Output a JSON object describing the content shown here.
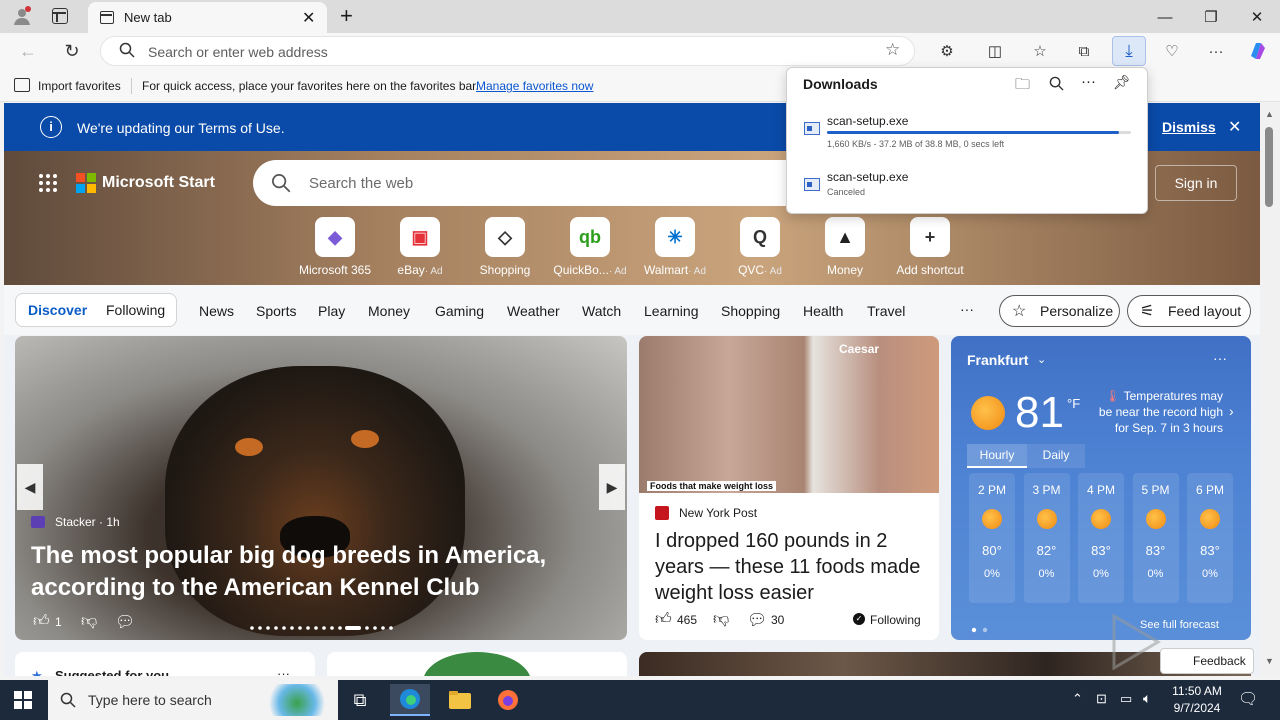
{
  "browser": {
    "tab_title": "New tab",
    "address_placeholder": "Search or enter web address"
  },
  "favorites_bar": {
    "import_label": "Import favorites",
    "hint": "For quick access, place your favorites here on the favorites bar.",
    "manage_link": "Manage favorites now"
  },
  "notice": {
    "text": "We're updating our Terms of Use.",
    "dismiss": "Dismiss"
  },
  "header": {
    "brand": "Microsoft Start",
    "search_placeholder": "Search the web",
    "sign_in": "Sign in"
  },
  "shortcuts": [
    {
      "label": "Microsoft 365",
      "ad": "",
      "icon": "m365-icon",
      "color": "#7c5cd6"
    },
    {
      "label": "eBay",
      "ad": "· Ad",
      "icon": "ebay-icon",
      "color": "#e53238"
    },
    {
      "label": "Shopping",
      "ad": "",
      "icon": "tag-icon",
      "color": "#333333"
    },
    {
      "label": "QuickBo...",
      "ad": "· Ad",
      "icon": "quickbooks-icon",
      "color": "#2ca01c"
    },
    {
      "label": "Walmart",
      "ad": "· Ad",
      "icon": "walmart-icon",
      "color": "#0071ce"
    },
    {
      "label": "QVC",
      "ad": "· Ad",
      "icon": "qvc-icon",
      "color": "#333333"
    },
    {
      "label": "Money",
      "ad": "",
      "icon": "money-icon",
      "color": "#222222"
    },
    {
      "label": "Add shortcut",
      "ad": "",
      "icon": "plus-icon",
      "color": "#333333"
    }
  ],
  "nav": {
    "discover": "Discover",
    "following": "Following",
    "items": [
      "News",
      "Sports",
      "Play",
      "Money",
      "Gaming",
      "Weather",
      "Watch",
      "Learning",
      "Shopping",
      "Health",
      "Travel"
    ],
    "more": "···",
    "personalize": "Personalize",
    "feed_layout": "Feed layout"
  },
  "hero_card": {
    "source": "Stacker · 1h",
    "headline": "The most popular big dog breeds in America, according to the American Kennel Club",
    "likes": "1"
  },
  "nyp_card": {
    "image_caption": "Foods that make weight loss",
    "image_text": "Caesar",
    "source": "New York Post",
    "headline": "I dropped 160 pounds in 2 years — these 11 foods made weight loss easier",
    "likes": "465",
    "comments": "30",
    "following": "Following"
  },
  "weather": {
    "city": "Frankfurt",
    "temp": "81",
    "unit": "°F",
    "alert": "Temperatures may be near the record high for Sep. 7 in 3 hours",
    "tab_hourly": "Hourly",
    "tab_daily": "Daily",
    "hours": [
      {
        "time": "2 PM",
        "temp": "80°",
        "precip": "0%"
      },
      {
        "time": "3 PM",
        "temp": "82°",
        "precip": "0%"
      },
      {
        "time": "4 PM",
        "temp": "83°",
        "precip": "0%"
      },
      {
        "time": "5 PM",
        "temp": "83°",
        "precip": "0%"
      },
      {
        "time": "6 PM",
        "temp": "83°",
        "precip": "0%"
      }
    ],
    "forecast_link": "See full forecast"
  },
  "bottom": {
    "suggested": "Suggested for you",
    "feedback": "Feedback"
  },
  "downloads": {
    "title": "Downloads",
    "items": [
      {
        "name": "scan-setup.exe",
        "status": "1,660 KB/s - 37.2 MB of 38.8 MB, 0 secs left",
        "progress": 0.96
      },
      {
        "name": "scan-setup.exe",
        "status": "Canceled",
        "progress": null
      }
    ]
  },
  "taskbar": {
    "search_placeholder": "Type here to search",
    "time": "11:50 AM",
    "date": "9/7/2024"
  }
}
